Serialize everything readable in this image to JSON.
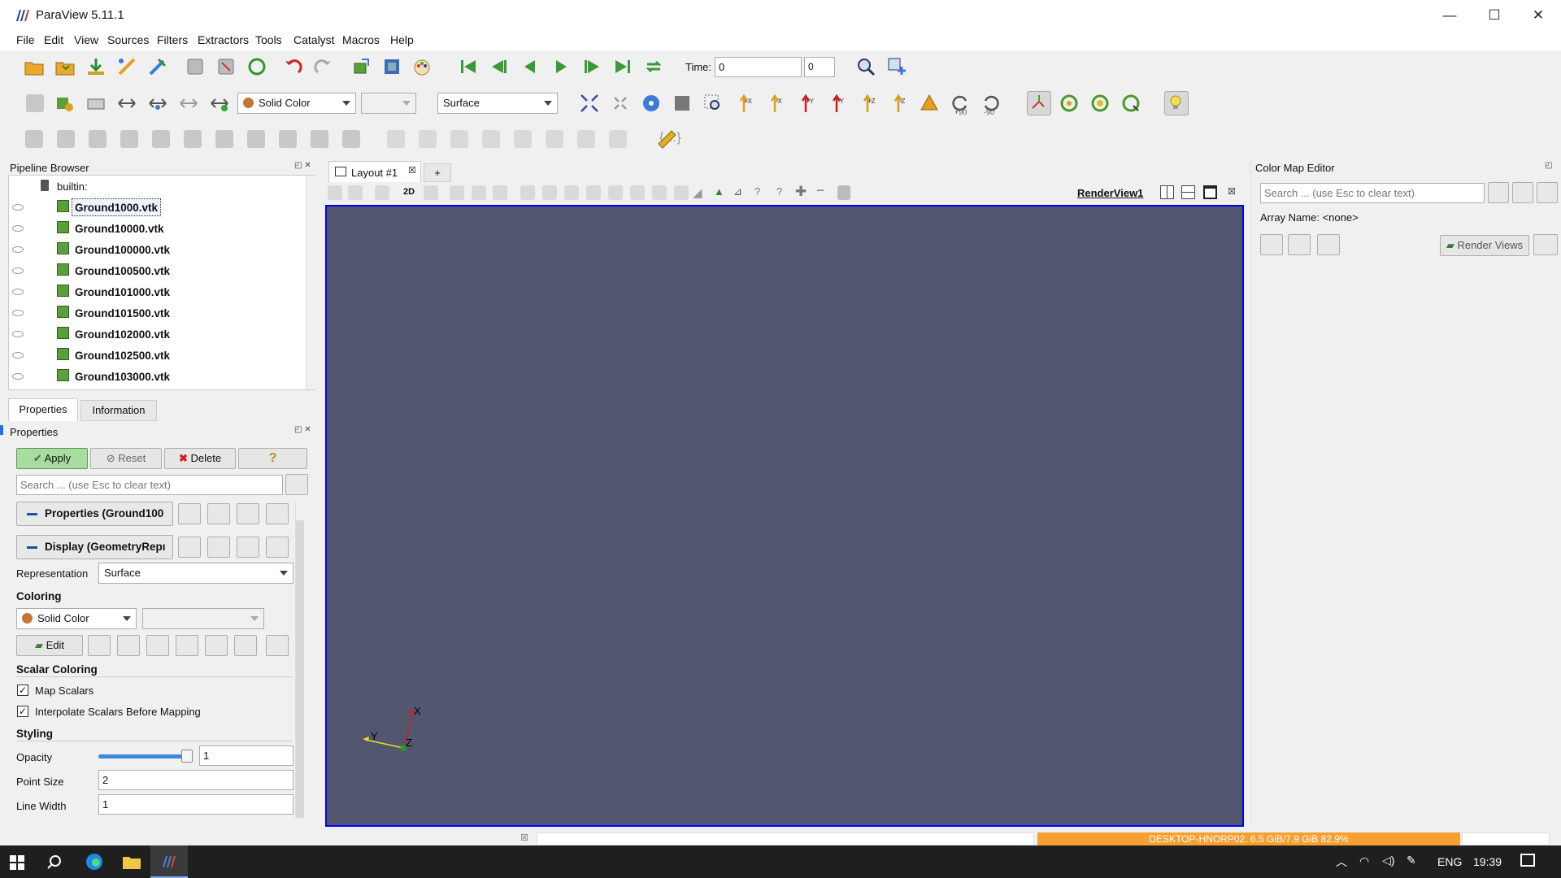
{
  "window": {
    "title": "ParaView 5.11.1",
    "minimize": "—",
    "maximize": "☐",
    "close": "✕"
  },
  "menu": [
    "File",
    "Edit",
    "View",
    "Sources",
    "Filters",
    "Extractors",
    "Tools",
    "Catalyst",
    "Macros",
    "Help"
  ],
  "toolbar1": {
    "time_label": "Time:",
    "time_value": "0",
    "time_index": "0"
  },
  "toolbar2": {
    "coloring": "Solid Color",
    "component": "",
    "representation": "Surface",
    "rot_plus": "+90",
    "rot_minus": "-90"
  },
  "pipeline": {
    "title": "Pipeline Browser",
    "root": "builtin:",
    "items": [
      "Ground1000.vtk",
      "Ground10000.vtk",
      "Ground100000.vtk",
      "Ground100500.vtk",
      "Ground101000.vtk",
      "Ground101500.vtk",
      "Ground102000.vtk",
      "Ground102500.vtk",
      "Ground103000.vtk"
    ]
  },
  "tabs": {
    "properties": "Properties",
    "information": "Information"
  },
  "properties": {
    "title": "Properties",
    "apply": "Apply",
    "reset": "Reset",
    "delete": "Delete",
    "help": "?",
    "search_placeholder": "Search ... (use Esc to clear text)",
    "section_properties": "Properties (Ground100",
    "section_display": "Display (GeometryRepı",
    "representation_label": "Representation",
    "representation_value": "Surface",
    "coloring_label": "Coloring",
    "coloring_value": "Solid Color",
    "edit": "Edit",
    "scalar_coloring_label": "Scalar Coloring",
    "map_scalars": "Map Scalars",
    "interpolate": "Interpolate Scalars Before Mapping",
    "styling_label": "Styling",
    "opacity_label": "Opacity",
    "opacity_value": "1",
    "opacity_fraction": 0.95,
    "point_size_label": "Point Size",
    "point_size_value": "2",
    "line_width_label": "Line Width",
    "line_width_value": "1"
  },
  "layout": {
    "tab": "Layout #1",
    "add": "+",
    "btn_2d": "2D",
    "view_name": "RenderView1"
  },
  "axes": {
    "x": "X",
    "y": "Y",
    "z": "Z"
  },
  "colormap": {
    "title": "Color Map Editor",
    "search_placeholder": "Search ... (use Esc to clear text)",
    "array_name": "Array Name: <none>",
    "render_views": "Render Views"
  },
  "status": {
    "memory": "DESKTOP-HNORP02: 6.5 GiB/7.9 GiB 82.9%"
  },
  "taskbar": {
    "lang": "ENG",
    "time": "19:39"
  },
  "colors": {
    "render_bg": "#52566e",
    "accent": "#0000ff",
    "memory_bar": "#f7a032"
  }
}
